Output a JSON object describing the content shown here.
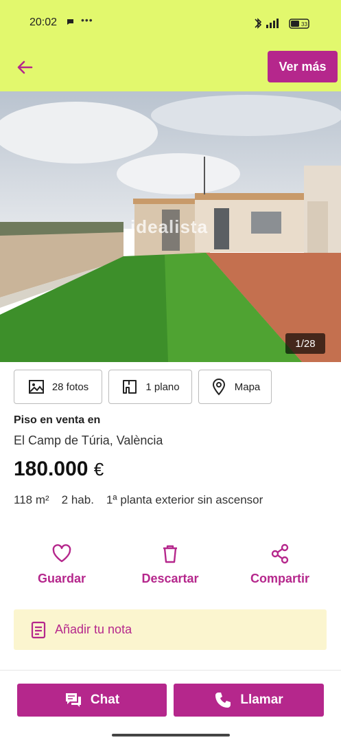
{
  "status": {
    "time": "20:02",
    "dots": "•••",
    "battery": "33"
  },
  "header": {
    "vermas_label": "Ver más"
  },
  "photo": {
    "watermark": "idealista",
    "counter": "1/28"
  },
  "media": {
    "fotos_label": "28 fotos",
    "plano_label": "1 plano",
    "mapa_label": "Mapa"
  },
  "listing": {
    "title": "Piso en venta en",
    "location": "El Camp de Túria, València",
    "price": "180.000",
    "currency": "€",
    "features": {
      "area": "118 m²",
      "rooms": "2 hab.",
      "floor": "1ª planta exterior sin ascensor"
    }
  },
  "actions": {
    "guardar": "Guardar",
    "descartar": "Descartar",
    "compartir": "Compartir"
  },
  "nota": {
    "label": "Añadir tu nota"
  },
  "cta": {
    "chat": "Chat",
    "llamar": "Llamar"
  },
  "colors": {
    "brand": "#b5278c",
    "header_bg": "#e2f86d",
    "nota_bg": "#fbf5cf"
  },
  "icons": [
    "arrow-left-icon",
    "photo-icon",
    "floorplan-icon",
    "map-pin-icon",
    "heart-icon",
    "trash-icon",
    "share-icon",
    "note-icon",
    "chat-icon",
    "phone-icon"
  ]
}
